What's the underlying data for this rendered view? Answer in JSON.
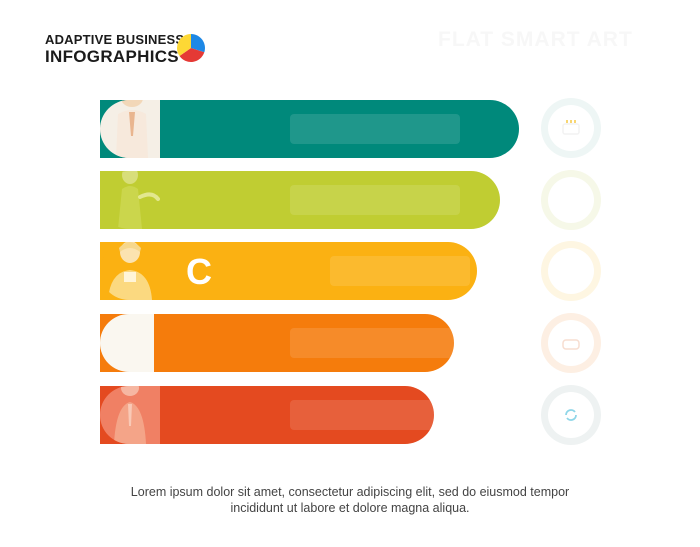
{
  "header": {
    "line1": "ADAPTIVE BUSINESS",
    "line2": "INFOGRAPHICS",
    "logo_icon": "pie-chart-logo-icon",
    "watermark": "FLAT SMART ART"
  },
  "rows": [
    {
      "label": "",
      "bar_color": "#00897b",
      "avatar_bg": "#f5efe6",
      "avatar_icon": "businessman-avatar-icon",
      "badge_icon": "cake-icon",
      "badge_color": "#eef6f5"
    },
    {
      "label": "",
      "bar_color": "#c0cd32",
      "avatar_bg": "#c0cd32",
      "avatar_icon": "woman-avatar-icon",
      "badge_icon": "chat-bubble-icon",
      "badge_color": "#f6f8e8"
    },
    {
      "label": "C",
      "bar_color": "#fbb112",
      "avatar_bg": "#fbb112",
      "avatar_icon": "blonde-person-avatar-icon",
      "badge_icon": "lightbulb-icon",
      "badge_color": "#fef6e2"
    },
    {
      "label": "",
      "bar_color": "#f57c0c",
      "avatar_bg": "#faf7f0",
      "avatar_icon": "person-avatar-icon",
      "badge_icon": "briefcase-icon",
      "badge_color": "#fdefe3"
    },
    {
      "label": "",
      "bar_color": "#e44a20",
      "avatar_bg": "#f08064",
      "avatar_icon": "man-avatar-icon",
      "badge_icon": "recycle-icon",
      "badge_color": "#eef2f2"
    }
  ],
  "caption": {
    "line1": "Lorem ipsum dolor sit amet, consectetur adipiscing elit, sed do eiusmod tempor",
    "line2": "incididunt ut labore et dolore magna aliqua."
  }
}
